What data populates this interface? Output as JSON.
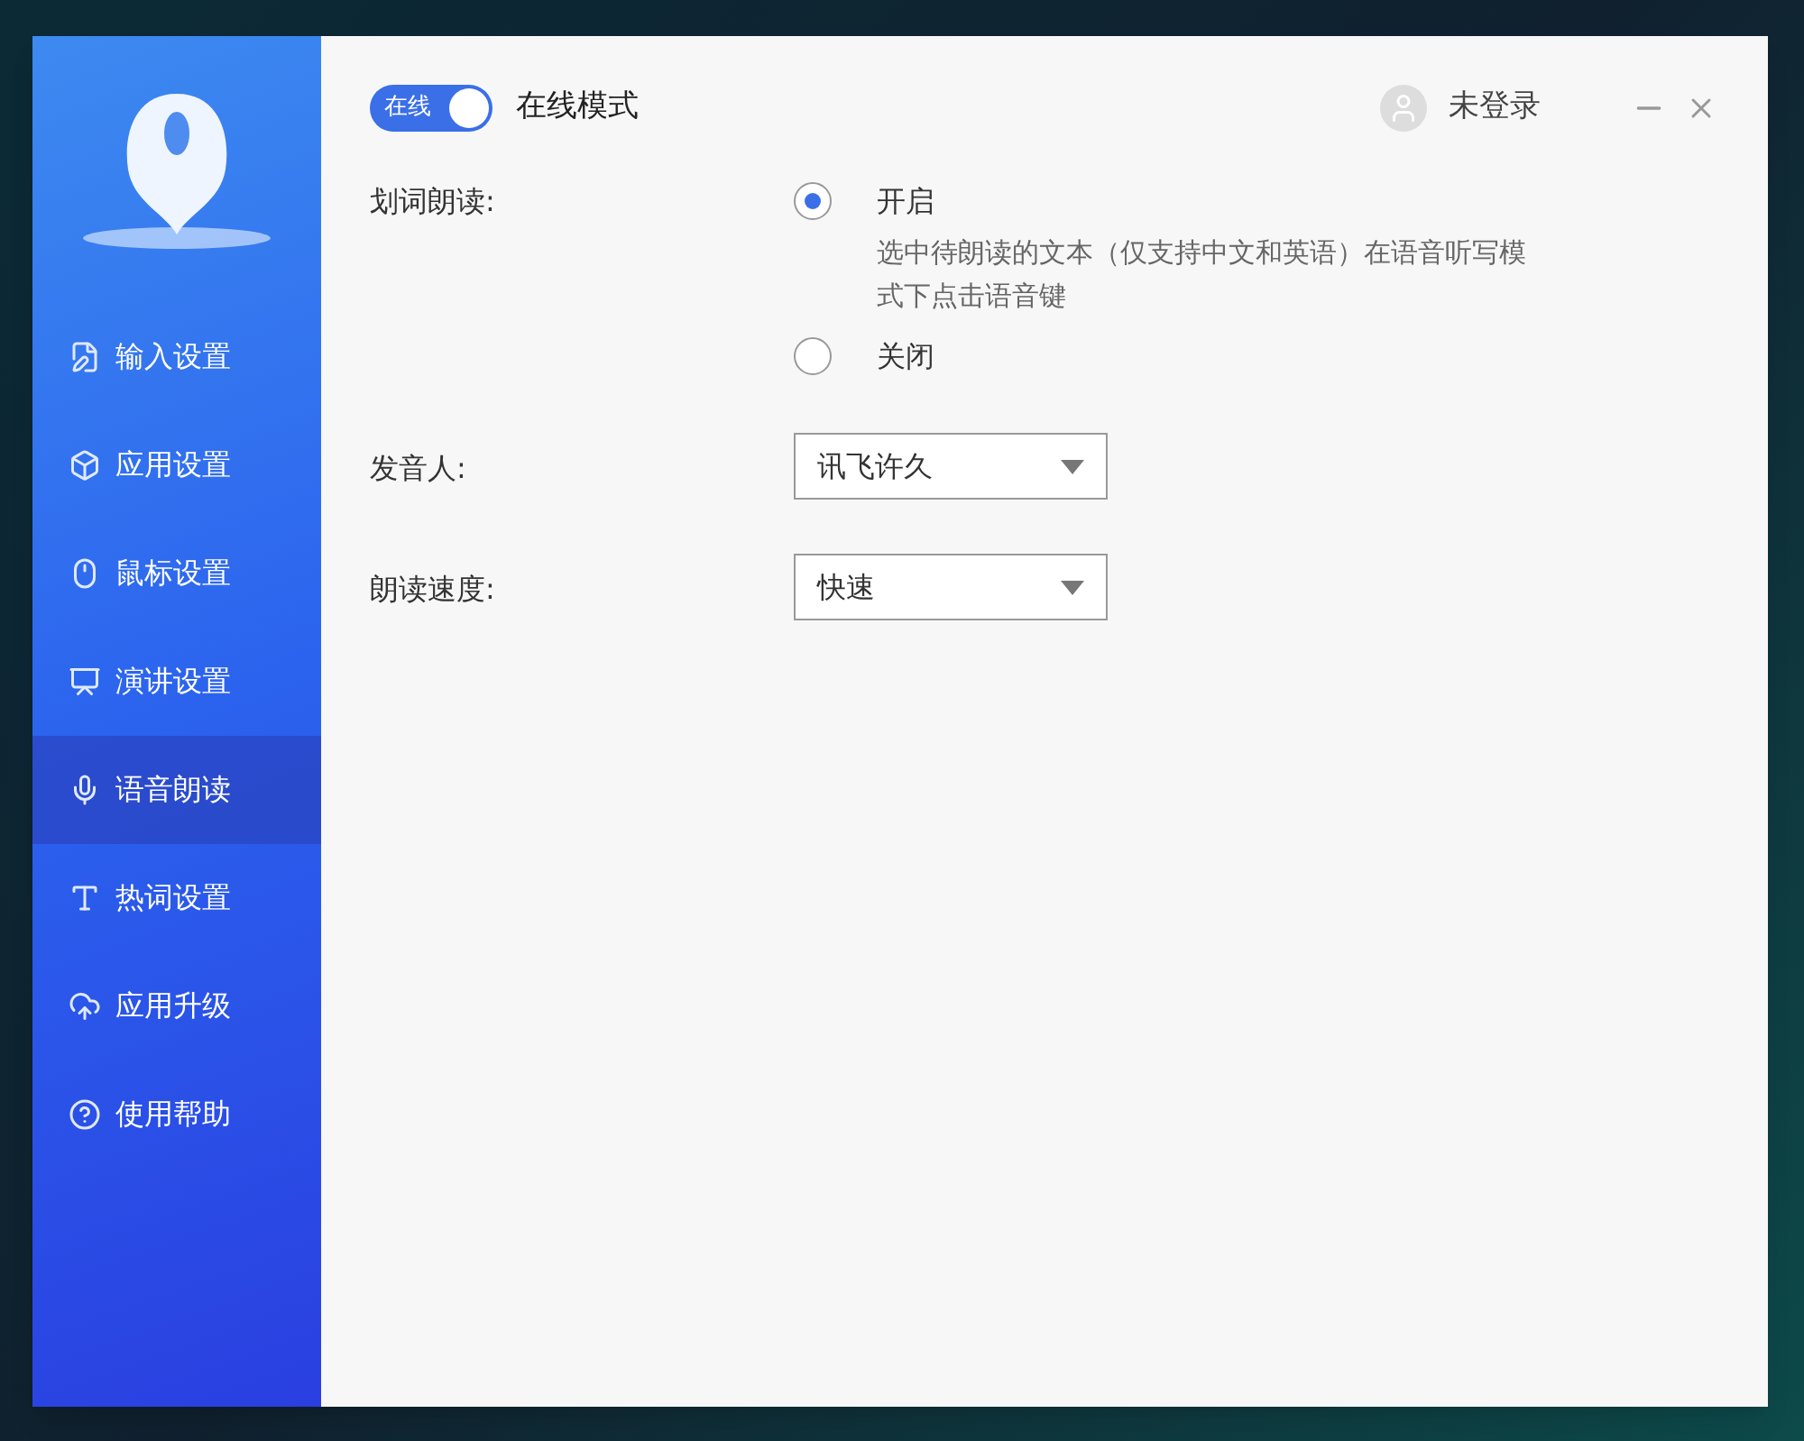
{
  "mode_switch": {
    "label": "在线",
    "on": true
  },
  "mode_label": "在线模式",
  "user": {
    "label": "未登录"
  },
  "sidebar": {
    "items": [
      {
        "label": "输入设置",
        "kind": "input",
        "selected": false
      },
      {
        "label": "应用设置",
        "kind": "app",
        "selected": false
      },
      {
        "label": "鼠标设置",
        "kind": "mouse",
        "selected": false
      },
      {
        "label": "演讲设置",
        "kind": "speech",
        "selected": false
      },
      {
        "label": "语音朗读",
        "kind": "voice",
        "selected": true
      },
      {
        "label": "热词设置",
        "kind": "hotword",
        "selected": false
      },
      {
        "label": "应用升级",
        "kind": "upgrade",
        "selected": false
      },
      {
        "label": "使用帮助",
        "kind": "help",
        "selected": false
      }
    ]
  },
  "settings": [
    {
      "kind": "radio",
      "label": "划词朗读:",
      "options": [
        {
          "label": "开启",
          "description": "选中待朗读的文本（仅支持中文和英语）在语音听写模式下点击语音键",
          "selected": true
        },
        {
          "label": "关闭",
          "selected": false
        }
      ]
    },
    {
      "kind": "select",
      "label": "发音人:",
      "value": "讯飞许久"
    },
    {
      "kind": "select",
      "label": "朗读速度:",
      "value": "快速"
    }
  ]
}
